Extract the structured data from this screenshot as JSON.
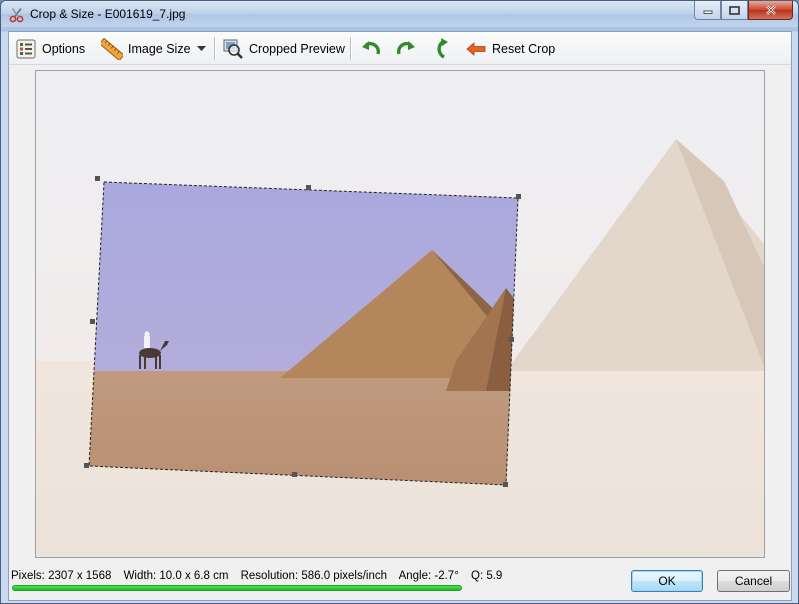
{
  "window": {
    "title": "Crop & Size - E001619_7.jpg",
    "icon": "scissors-icon"
  },
  "toolbar": {
    "options_label": "Options",
    "image_size_label": "Image Size",
    "cropped_preview_label": "Cropped Preview",
    "reset_crop_label": "Reset Crop",
    "icons": [
      "options-icon",
      "ruler-icon",
      "dropdown-arrow-icon",
      "magnifier-icon",
      "rotate-left-icon",
      "rotate-right-icon",
      "flip-icon",
      "reset-arrow-icon"
    ]
  },
  "status": {
    "pixels": "Pixels: 2307 x 1568",
    "width": "Width: 10.0 x 6.8 cm",
    "resolution": "Resolution: 586.0 pixels/inch",
    "angle": "Angle: -2.7°",
    "quality": "Q: 5.9",
    "progress": 1.0
  },
  "buttons": {
    "ok_label": "OK",
    "cancel_label": "Cancel"
  },
  "colors": {
    "accent_green": "#1fc026",
    "ok_border": "#3c7fb1",
    "close_red": "#c7452c"
  }
}
